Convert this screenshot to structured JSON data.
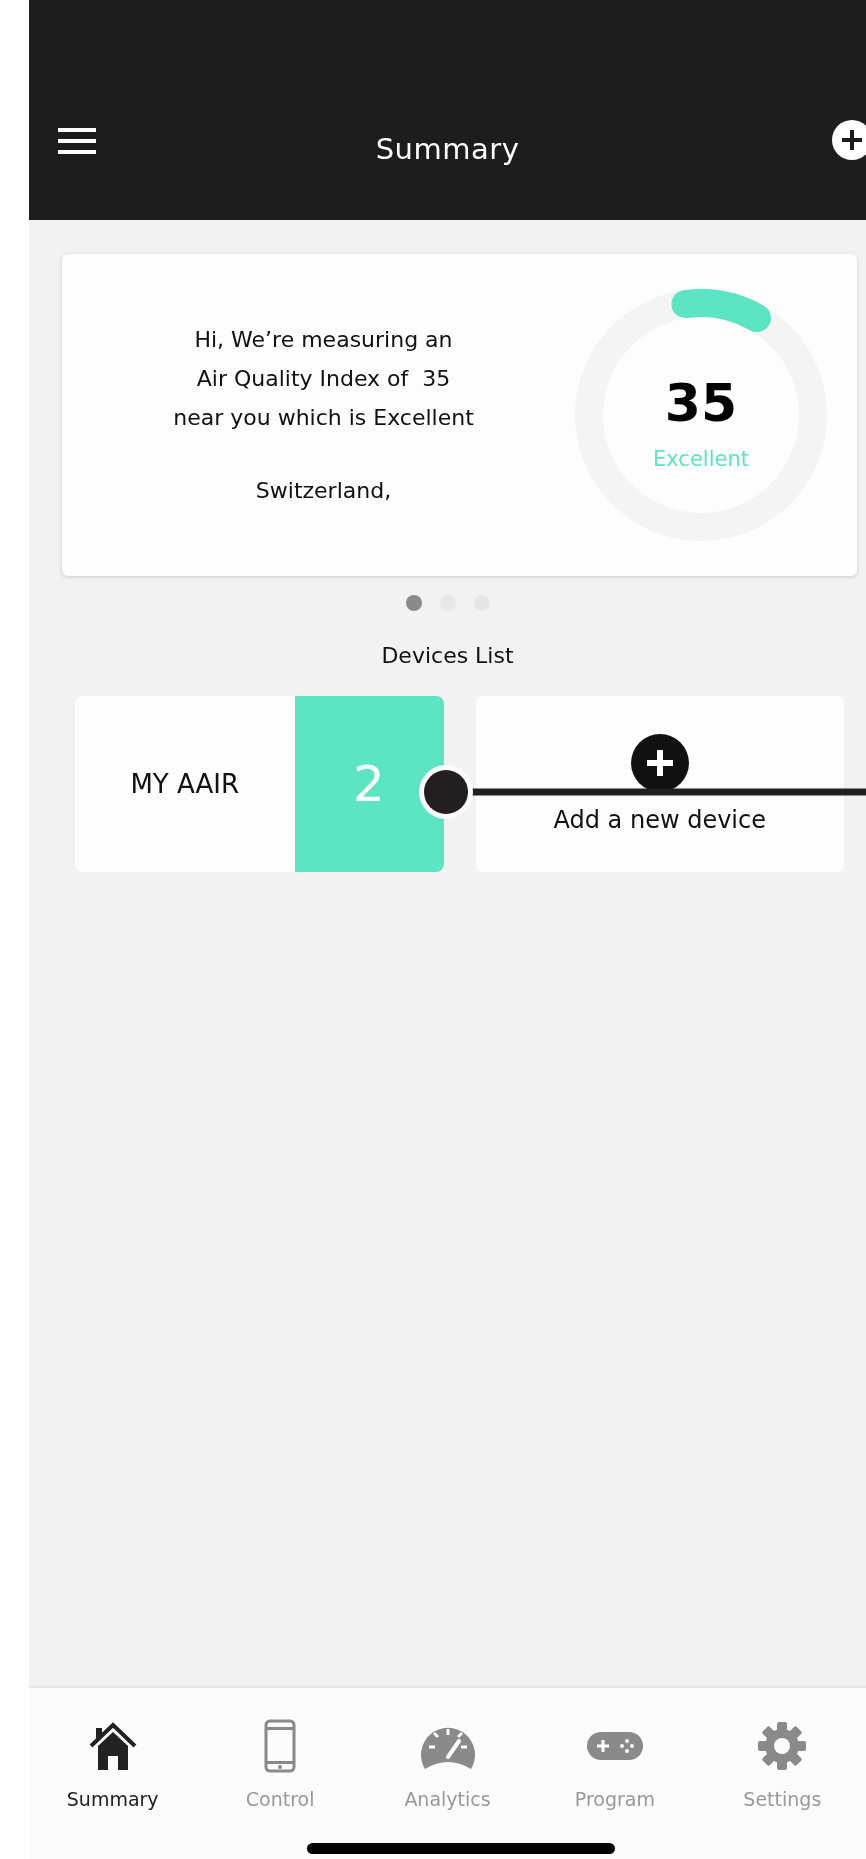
{
  "header": {
    "title": "Summary"
  },
  "summary_card": {
    "message": "Hi, We’re measuring an\nAir Quality Index of  35\nnear you which is Excellent",
    "location": "Switzerland,",
    "gauge": {
      "value": "35",
      "rating": "Excellent"
    }
  },
  "pager": [
    {
      "selected": true
    },
    {
      "selected": false
    },
    {
      "selected": false
    }
  ],
  "devices_title": "Devices List",
  "devices": [
    {
      "kind": "device",
      "name": "MY AAIR",
      "count": "2"
    },
    {
      "kind": "add",
      "label": "Add a new device"
    }
  ],
  "tabs": [
    {
      "kind": "home",
      "label": "Summary",
      "selected": true
    },
    {
      "kind": "phone",
      "label": "Control",
      "selected": false
    },
    {
      "kind": "gauge",
      "label": "Analytics",
      "selected": false
    },
    {
      "kind": "gamepad",
      "label": "Program",
      "selected": false
    },
    {
      "kind": "gear",
      "label": "Settings",
      "selected": false
    }
  ]
}
